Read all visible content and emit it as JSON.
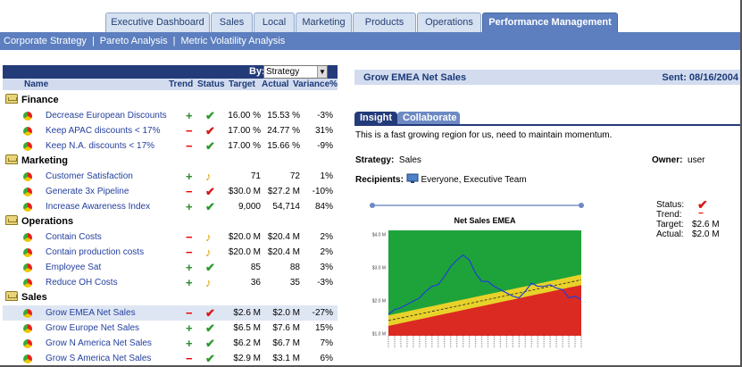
{
  "tabs": [
    {
      "label": "Executive Dashboard",
      "active": false
    },
    {
      "label": "Sales",
      "active": false
    },
    {
      "label": "Local",
      "active": false
    },
    {
      "label": "Marketing",
      "active": false
    },
    {
      "label": "Products",
      "active": false
    },
    {
      "label": "Operations",
      "active": false
    },
    {
      "label": "Performance Management",
      "active": true
    }
  ],
  "subnav": [
    "Corporate Strategy",
    "Pareto Analysis",
    "Metric Volatility Analysis"
  ],
  "scorecard": {
    "by_label": "By:",
    "by_value": "Strategy",
    "headers": {
      "name": "Name",
      "trend": "Trend",
      "status": "Status",
      "target": "Target",
      "actual": "Actual",
      "variance": "Variance%"
    },
    "groups": [
      {
        "name": "Finance",
        "rows": [
          {
            "name": "Decrease European Discounts",
            "trend": "+",
            "status": "good",
            "target": "16.00 %",
            "actual": "15.53 %",
            "variance": "-3%"
          },
          {
            "name": "Keep APAC discounts < 17%",
            "trend": "−",
            "status": "bad",
            "target": "17.00 %",
            "actual": "24.77 %",
            "variance": "31%"
          },
          {
            "name": "Keep N.A. discounts < 17%",
            "trend": "−",
            "status": "good",
            "target": "17.00 %",
            "actual": "15.66 %",
            "variance": "-9%"
          }
        ]
      },
      {
        "name": "Marketing",
        "rows": [
          {
            "name": "Customer Satisfaction",
            "trend": "+",
            "status": "warn",
            "target": "71",
            "actual": "72",
            "variance": "1%"
          },
          {
            "name": "Generate 3x Pipeline",
            "trend": "−",
            "status": "bad",
            "target": "$30.0 M",
            "actual": "$27.2 M",
            "variance": "-10%"
          },
          {
            "name": "Increase Awareness Index",
            "trend": "+",
            "status": "good",
            "target": "9,000",
            "actual": "54,714",
            "variance": "84%"
          }
        ]
      },
      {
        "name": "Operations",
        "rows": [
          {
            "name": "Contain Costs",
            "trend": "−",
            "status": "warn",
            "target": "$20.0 M",
            "actual": "$20.4 M",
            "variance": "2%"
          },
          {
            "name": "Contain production costs",
            "trend": "−",
            "status": "warn",
            "target": "$20.0 M",
            "actual": "$20.4 M",
            "variance": "2%"
          },
          {
            "name": "Employee Sat",
            "trend": "+",
            "status": "good",
            "target": "85",
            "actual": "88",
            "variance": "3%"
          },
          {
            "name": "Reduce OH Costs",
            "trend": "+",
            "status": "warn",
            "target": "36",
            "actual": "35",
            "variance": "-3%"
          }
        ]
      },
      {
        "name": "Sales",
        "rows": [
          {
            "name": "Grow EMEA Net Sales",
            "trend": "−",
            "status": "bad",
            "target": "$2.6 M",
            "actual": "$2.0 M",
            "variance": "-27%",
            "highlight": true
          },
          {
            "name": "Grow Europe Net Sales",
            "trend": "+",
            "status": "good",
            "target": "$6.5 M",
            "actual": "$7.6 M",
            "variance": "15%"
          },
          {
            "name": "Grow N America Net Sales",
            "trend": "+",
            "status": "good",
            "target": "$6.2 M",
            "actual": "$6.7 M",
            "variance": "7%"
          },
          {
            "name": "Grow S America Net Sales",
            "trend": "−",
            "status": "good",
            "target": "$2.9 M",
            "actual": "$3.1 M",
            "variance": "6%"
          }
        ]
      }
    ]
  },
  "detail": {
    "title": "Grow EMEA Net Sales",
    "sent": "Sent: 08/16/2004",
    "tab_insight": "Insight",
    "tab_collaborate": "Collaborate",
    "insight_text": "This is a fast growing region for us, need to maintain momentum.",
    "strategy_label": "Strategy:",
    "strategy_value": "Sales",
    "owner_label": "Owner:",
    "owner_value": "user",
    "recipients_label": "Recipients:",
    "recipients_value": "Everyone, Executive Team",
    "side": {
      "status_label": "Status:",
      "trend_label": "Trend:",
      "target_label": "Target:",
      "target_value": "$2.6 M",
      "actual_label": "Actual:",
      "actual_value": "$2.0 M"
    }
  },
  "colors": {
    "nav": "#5d7fbf",
    "header": "#243b7a",
    "green": "#1ea33a",
    "yellow": "#e8d22a",
    "red": "#db2a22",
    "line": "#1f3fd6"
  },
  "chart_data": {
    "type": "area",
    "title": "Net Sales EMEA",
    "xlabel": "",
    "ylabel": "",
    "yticks": [
      "$1.0 M",
      "$2.0 M",
      "$3.0 M",
      "$4.0 M"
    ],
    "ylim": [
      0.9,
      4.1
    ],
    "points": 32,
    "red_upper": [
      1.2,
      1.24,
      1.28,
      1.32,
      1.36,
      1.4,
      1.44,
      1.48,
      1.52,
      1.56,
      1.6,
      1.64,
      1.68,
      1.72,
      1.76,
      1.8,
      1.84,
      1.88,
      1.92,
      1.96,
      2.0,
      2.04,
      2.08,
      2.12,
      2.16,
      2.2,
      2.24,
      2.28,
      2.32,
      2.36,
      2.4,
      2.44
    ],
    "yellow_upper": [
      1.52,
      1.56,
      1.6,
      1.64,
      1.68,
      1.72,
      1.76,
      1.8,
      1.84,
      1.88,
      1.92,
      1.96,
      2.0,
      2.04,
      2.08,
      2.12,
      2.16,
      2.2,
      2.24,
      2.28,
      2.32,
      2.36,
      2.4,
      2.44,
      2.48,
      2.52,
      2.56,
      2.6,
      2.64,
      2.68,
      2.72,
      2.76
    ],
    "target": [
      1.36,
      1.4,
      1.44,
      1.48,
      1.52,
      1.56,
      1.6,
      1.64,
      1.68,
      1.72,
      1.76,
      1.8,
      1.84,
      1.88,
      1.92,
      1.96,
      2.0,
      2.04,
      2.08,
      2.12,
      2.16,
      2.2,
      2.24,
      2.28,
      2.32,
      2.36,
      2.4,
      2.44,
      2.48,
      2.52,
      2.56,
      2.6
    ],
    "actual": [
      1.55,
      1.7,
      1.75,
      1.85,
      1.95,
      2.05,
      2.25,
      2.4,
      2.45,
      2.7,
      3.0,
      3.2,
      3.35,
      3.2,
      2.8,
      2.55,
      2.55,
      2.4,
      2.3,
      2.2,
      2.1,
      2.05,
      2.25,
      2.5,
      2.4,
      2.4,
      2.45,
      2.35,
      2.3,
      2.05,
      2.1,
      2.0
    ],
    "grid": false
  }
}
